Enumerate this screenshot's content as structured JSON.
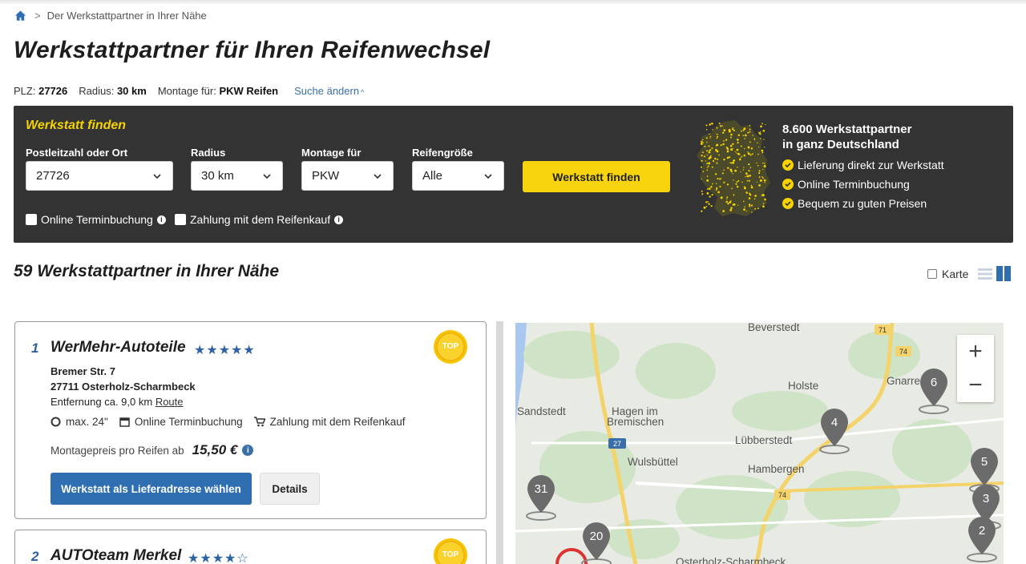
{
  "breadcrumb": {
    "current": "Der Werkstattpartner in Ihrer Nähe"
  },
  "page_title": "Werkstattpartner für Ihren Reifenwechsel",
  "summary": {
    "plz_label": "PLZ:",
    "plz_value": "27726",
    "radius_label": "Radius:",
    "radius_value": "30 km",
    "montage_label": "Montage für:",
    "montage_value": "PKW Reifen",
    "change_label": "Suche ändern"
  },
  "finder": {
    "heading": "Werkstatt finden",
    "fields": {
      "plz": {
        "label": "Postleitzahl oder Ort",
        "value": "27726"
      },
      "radius": {
        "label": "Radius",
        "value": "30 km"
      },
      "montage": {
        "label": "Montage für",
        "value": "PKW"
      },
      "size": {
        "label": "Reifengröße",
        "value": "Alle"
      }
    },
    "submit_label": "Werkstatt finden",
    "checkbox_online": "Online Terminbuchung",
    "checkbox_payment": "Zahlung mit dem Reifenkauf",
    "partners_title_1": "8.600 Werkstattpartner",
    "partners_title_2": "in ganz Deutschland",
    "benefits": [
      "Lieferung direkt zur Werkstatt",
      "Online Terminbuchung",
      "Bequem zu guten Preisen"
    ]
  },
  "results_heading": "59 Werkstattpartner in Ihrer Nähe",
  "view_toggle": {
    "map_label": "Karte"
  },
  "workshops": [
    {
      "rank": "1",
      "name": "WerMehr-Autoteile",
      "stars_text": "★★★★★",
      "rating": 5,
      "badge": "TOP",
      "street": "Bremer Str. 7",
      "city": "27711 Osterholz-Scharmbeck",
      "distance": "Entfernung ca. 9,0 km",
      "route_label": "Route",
      "feature_size": "max. 24\"",
      "feature_online": "Online Terminbuchung",
      "feature_payment": "Zahlung mit dem Reifenkauf",
      "price_label": "Montagepreis pro Reifen ab",
      "price_value": "15,50 €",
      "primary_button": "Werkstatt als Lieferadresse wählen",
      "details_button": "Details"
    },
    {
      "rank": "2",
      "name": "AUTOteam Merkel",
      "stars_text": "★★★★☆",
      "rating": 4,
      "badge": "TOP"
    }
  ],
  "map": {
    "places": [
      "Beverstedt",
      "Holste",
      "Gnarrenburg",
      "Sandstedt",
      "Hagen im",
      "Bremischen",
      "Lübberstedt",
      "Wulsbüttel",
      "Hambergen",
      "Osterholz-Scharmbeck"
    ],
    "road_numbers": [
      "71",
      "74",
      "27",
      "74"
    ],
    "pins": [
      "6",
      "4",
      "5",
      "31",
      "3",
      "20",
      "2"
    ],
    "zoom_in": "+",
    "zoom_out": "−"
  }
}
